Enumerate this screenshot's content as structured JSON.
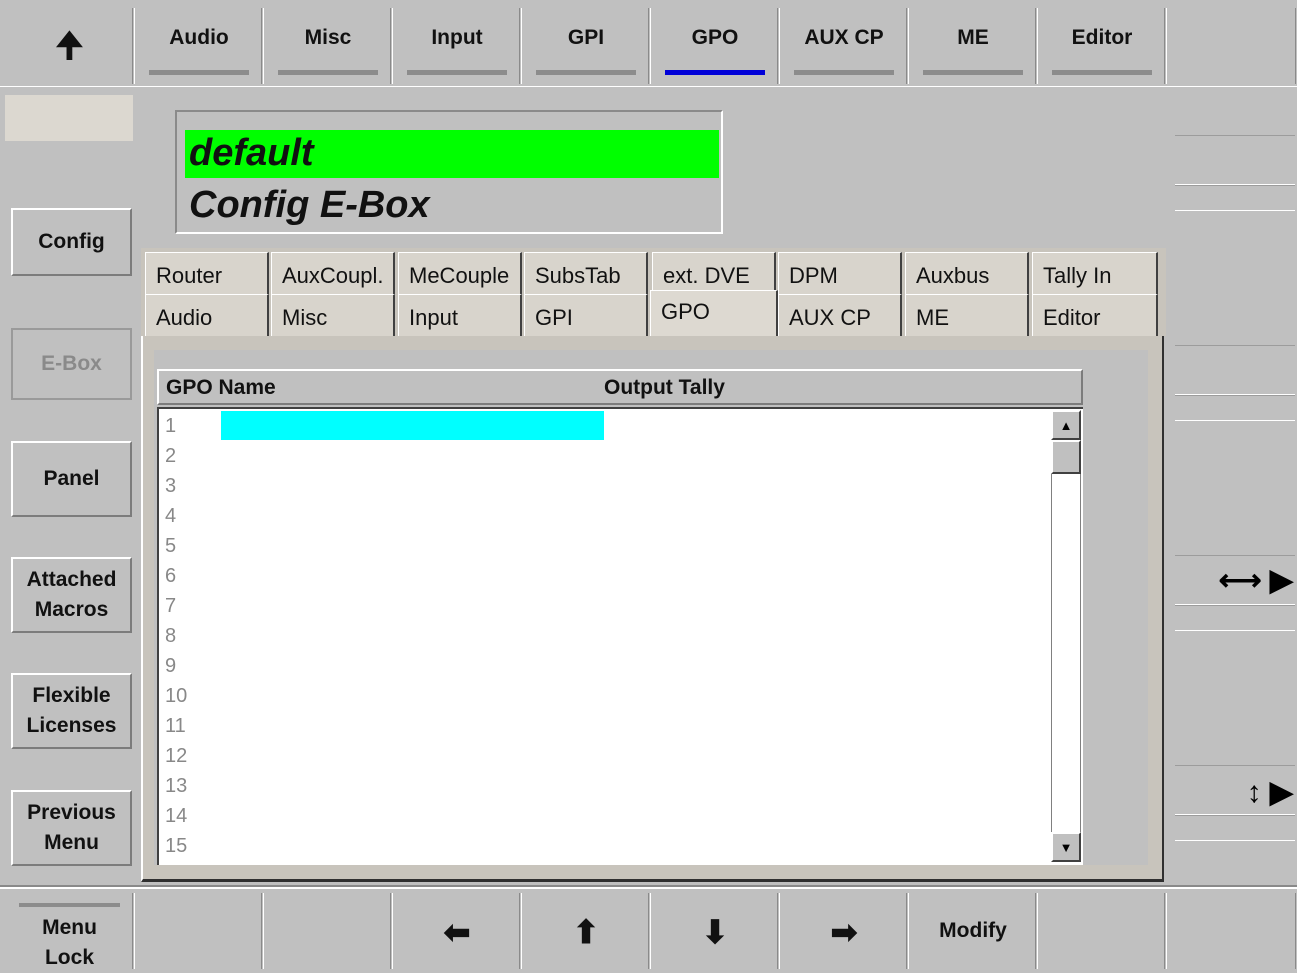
{
  "top_tabs": {
    "up_arrow": "🠉",
    "items": [
      {
        "label": "Audio",
        "active": false
      },
      {
        "label": "Misc",
        "active": false
      },
      {
        "label": "Input",
        "active": false
      },
      {
        "label": "GPI",
        "active": false
      },
      {
        "label": "GPO",
        "active": true
      },
      {
        "label": "AUX CP",
        "active": false
      },
      {
        "label": "ME",
        "active": false
      },
      {
        "label": "Editor",
        "active": false
      }
    ],
    "active_color": "#0000d8"
  },
  "left_menu": {
    "config": "Config",
    "ebox": "E-Box",
    "panel": "Panel",
    "attached_macros_l1": "Attached",
    "attached_macros_l2": "Macros",
    "flexible_licenses_l1": "Flexible",
    "flexible_licenses_l2": "Licenses",
    "previous_menu_l1": "Previous",
    "previous_menu_l2": "Menu"
  },
  "title_box": {
    "line1": "default",
    "line2": "Config E-Box",
    "highlight_color": "#00ff00"
  },
  "inner_tabs": {
    "row1": [
      "Router",
      "AuxCoupl.",
      "MeCouple",
      "SubsTab",
      "ext. DVE",
      "DPM",
      "Auxbus",
      "Tally In"
    ],
    "row2": [
      "Audio",
      "Misc",
      "Input",
      "GPI",
      "GPO",
      "AUX CP",
      "ME",
      "Editor"
    ],
    "selected": "GPO"
  },
  "list": {
    "headers": {
      "name": "GPO Name",
      "tally": "Output Tally"
    },
    "rows": [
      "1",
      "2",
      "3",
      "4",
      "5",
      "6",
      "7",
      "8",
      "9",
      "10",
      "11",
      "12",
      "13",
      "14",
      "15"
    ],
    "selection_color": "#00ffff"
  },
  "right_menu": {
    "horizontal_icon": "⟷ ▶",
    "vertical_icon": "↕ ▶"
  },
  "bottom_bar": {
    "menu_lock_l1": "Menu",
    "menu_lock_l2": "Lock",
    "left_arrow": "⬅",
    "up_arrow": "⬆",
    "down_arrow": "⬇",
    "right_arrow": "➡",
    "modify": "Modify"
  }
}
